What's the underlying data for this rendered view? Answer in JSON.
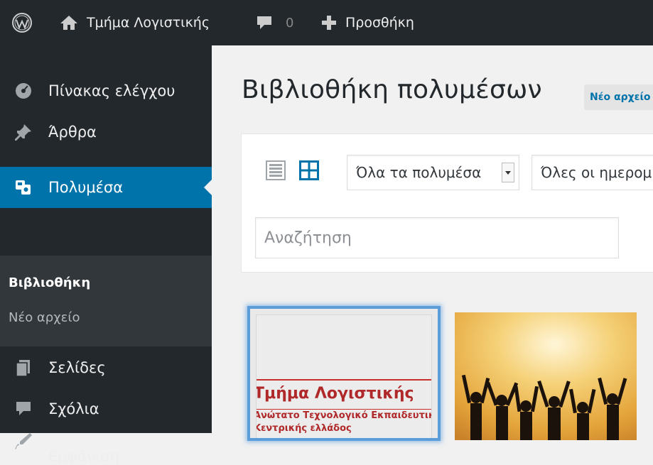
{
  "adminbar": {
    "site_name": "Τμήμα Λογιστικής",
    "comments_count": "0",
    "new_label": "Προσθήκη"
  },
  "sidebar": {
    "items": [
      {
        "label": "Πίνακας ελέγχου",
        "icon": "dashboard-icon"
      },
      {
        "label": "Άρθρα",
        "icon": "pin-icon"
      },
      {
        "label": "Πολυμέσα",
        "icon": "media-icon",
        "active": true
      },
      {
        "label": "Σελίδες",
        "icon": "pages-icon"
      },
      {
        "label": "Σχόλια",
        "icon": "comments-icon"
      },
      {
        "label": "Εμφάνιση",
        "icon": "appearance-icon"
      }
    ],
    "submenu": [
      {
        "label": "Βιβλιοθήκη",
        "current": true
      },
      {
        "label": "Νέο αρχείο"
      }
    ]
  },
  "main": {
    "title": "Βιβλιοθήκη πολυμέσων",
    "add_new_label": "Νέο αρχείο",
    "filter_type": "Όλα τα πολυμέσα",
    "filter_date": "Όλες οι ημερομηνίες",
    "search_placeholder": "Αναζήτηση"
  },
  "media": {
    "tile1": {
      "title": "Τμήμα Λογιστικής",
      "line1": "Ανώτατο Τεχνολογικό Εκπαιδευτικό",
      "line2": "Κεντρικής ελλάδος"
    }
  },
  "colors": {
    "adminbar_bg": "#23282d",
    "active_menu": "#0073aa",
    "accent": "#0073aa",
    "selection_border": "#5b9dd9"
  }
}
